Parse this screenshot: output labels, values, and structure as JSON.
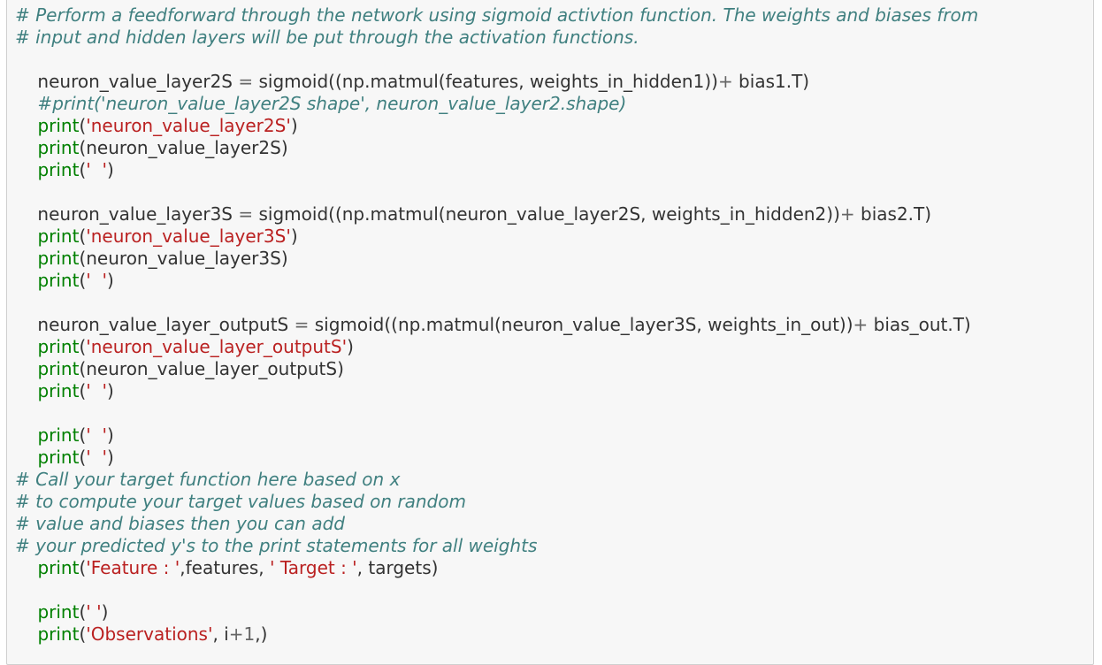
{
  "colors": {
    "comment": "#408080",
    "keyword": "#008000",
    "string": "#ba2121",
    "operator": "#666666",
    "text": "#333333",
    "cell_background": "#f7f7f7"
  },
  "code": {
    "l1": "# Perform a feedforward through the network using sigmoid activtion function. The weights and biases from",
    "l2": "# input and hidden layers will be put through the activation functions.",
    "l4_a": "    neuron_value_layer2S ",
    "l4_op1": "=",
    "l4_b": " sigmoid((np.matmul(features, weights_in_hidden1))",
    "l4_op2": "+",
    "l4_c": " bias1.T)",
    "l5": "    #print('neuron_value_layer2S shape', neuron_value_layer2.shape)",
    "l6_kw": "print",
    "l6_str": "'neuron_value_layer2S'",
    "l7_kw": "print",
    "l7_arg": "neuron_value_layer2S",
    "l8_kw": "print",
    "l8_str": "'  '",
    "l10_a": "    neuron_value_layer3S ",
    "l10_op1": "=",
    "l10_b": " sigmoid((np.matmul(neuron_value_layer2S, weights_in_hidden2))",
    "l10_op2": "+",
    "l10_c": " bias2.T)",
    "l11_kw": "print",
    "l11_str": "'neuron_value_layer3S'",
    "l12_kw": "print",
    "l12_arg": "neuron_value_layer3S",
    "l13_kw": "print",
    "l13_str": "'  '",
    "l15_a": "    neuron_value_layer_outputS ",
    "l15_op1": "=",
    "l15_b": " sigmoid((np.matmul(neuron_value_layer3S, weights_in_out))",
    "l15_op2": "+",
    "l15_c": " bias_out.T)",
    "l16_kw": "print",
    "l16_str": "'neuron_value_layer_outputS'",
    "l17_kw": "print",
    "l17_arg": "neuron_value_layer_outputS",
    "l18_kw": "print",
    "l18_str": "'  '",
    "l20_kw": "print",
    "l20_str": "'  '",
    "l21_kw": "print",
    "l21_str": "'  '",
    "l22": "# Call your target function here based on x",
    "l23": "# to compute your target values based on random",
    "l24": "# value and biases then you can add",
    "l25": "# your predicted y's to the print statements for all weights",
    "l26_kw": "print",
    "l26_str1": "'Feature : '",
    "l26_mid": ",features, ",
    "l26_str2": "' Target : '",
    "l26_end": ", targets",
    "l28_kw": "print",
    "l28_str": "' '",
    "l29_kw": "print",
    "l29_str": "'Observations'",
    "l29_mid": ", i",
    "l29_op": "+",
    "l29_num": "1",
    "l29_end": ",)"
  }
}
